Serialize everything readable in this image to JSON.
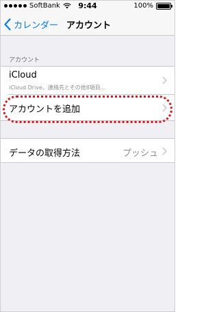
{
  "status_bar": {
    "carrier": "SoftBank",
    "time": "9:44",
    "battery": "100%",
    "battery_level": 1.0
  },
  "nav": {
    "back_label": "カレンダー",
    "title": "アカウント"
  },
  "accounts_section": {
    "header": "アカウント",
    "icloud": {
      "title": "iCloud",
      "subtitle": "iCloud Drive、連絡先とその他8項目..."
    },
    "add_account": {
      "title": "アカウントを追加"
    }
  },
  "fetch": {
    "title": "データの取得方法",
    "value": "プッシュ"
  },
  "colors": {
    "accent": "#007aff",
    "highlight": "#e0121b",
    "background": "#efeff4"
  },
  "icons": [
    "signal-dots-icon",
    "wifi-icon",
    "battery-icon",
    "back-chevron-icon",
    "chevron-right-icon"
  ]
}
